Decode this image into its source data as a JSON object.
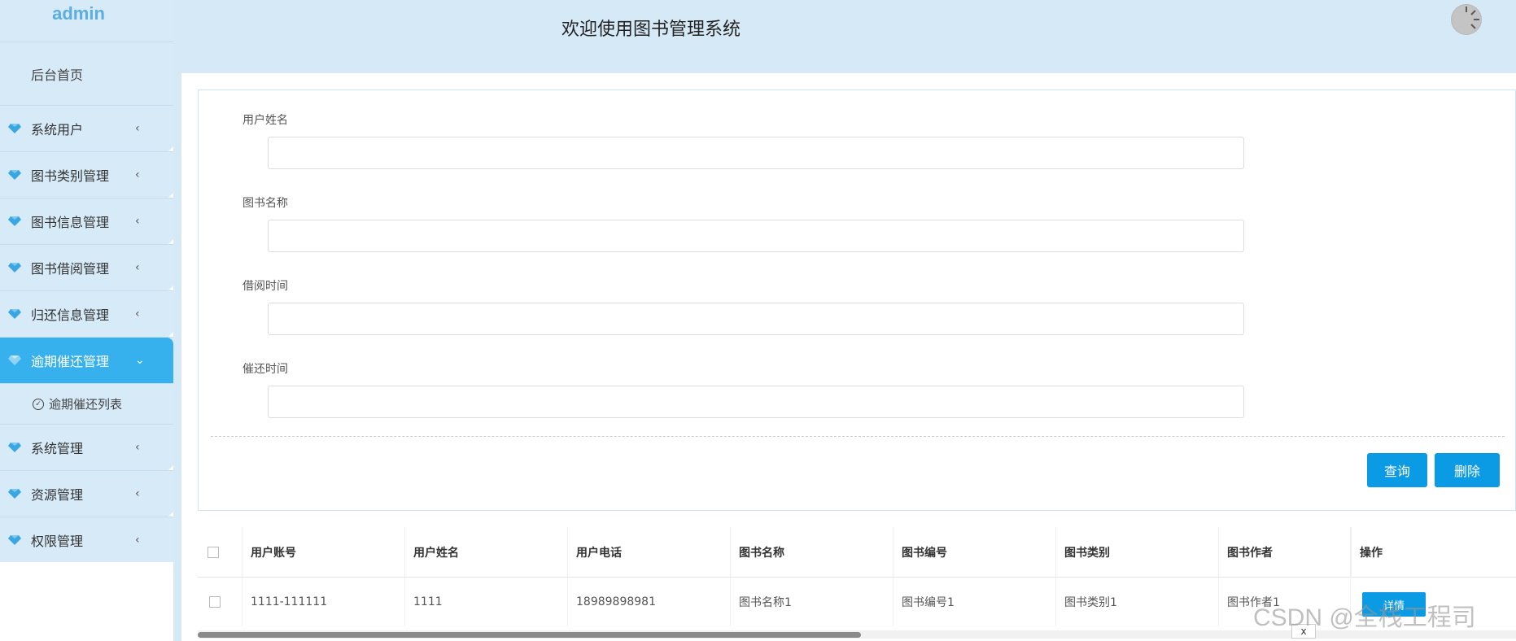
{
  "sidebar": {
    "brand": "admin",
    "home": "后台首页",
    "items": [
      {
        "label": "系统用户"
      },
      {
        "label": "图书类别管理"
      },
      {
        "label": "图书信息管理"
      },
      {
        "label": "图书借阅管理"
      },
      {
        "label": "归还信息管理"
      },
      {
        "label": "逾期催还管理"
      },
      {
        "label": "系统管理"
      },
      {
        "label": "资源管理"
      },
      {
        "label": "权限管理"
      }
    ],
    "sub_item": "逾期催还列表"
  },
  "header": {
    "title": "欢迎使用图书管理系统"
  },
  "form": {
    "fields": [
      {
        "label": "用户姓名",
        "value": ""
      },
      {
        "label": "图书名称",
        "value": ""
      },
      {
        "label": "借阅时间",
        "value": ""
      },
      {
        "label": "催还时间",
        "value": ""
      }
    ],
    "search_label": "查询",
    "delete_label": "删除"
  },
  "table": {
    "headers": [
      "用户账号",
      "用户姓名",
      "用户电话",
      "图书名称",
      "图书编号",
      "图书类别",
      "图书作者",
      "操作"
    ],
    "rows": [
      {
        "cells": [
          "1111-111111",
          "1111",
          "18989898981",
          "图书名称1",
          "图书编号1",
          "图书类别1",
          "图书作者1"
        ],
        "action": "详情"
      }
    ]
  },
  "close_label": "x",
  "watermark": "CSDN @全栈工程司"
}
